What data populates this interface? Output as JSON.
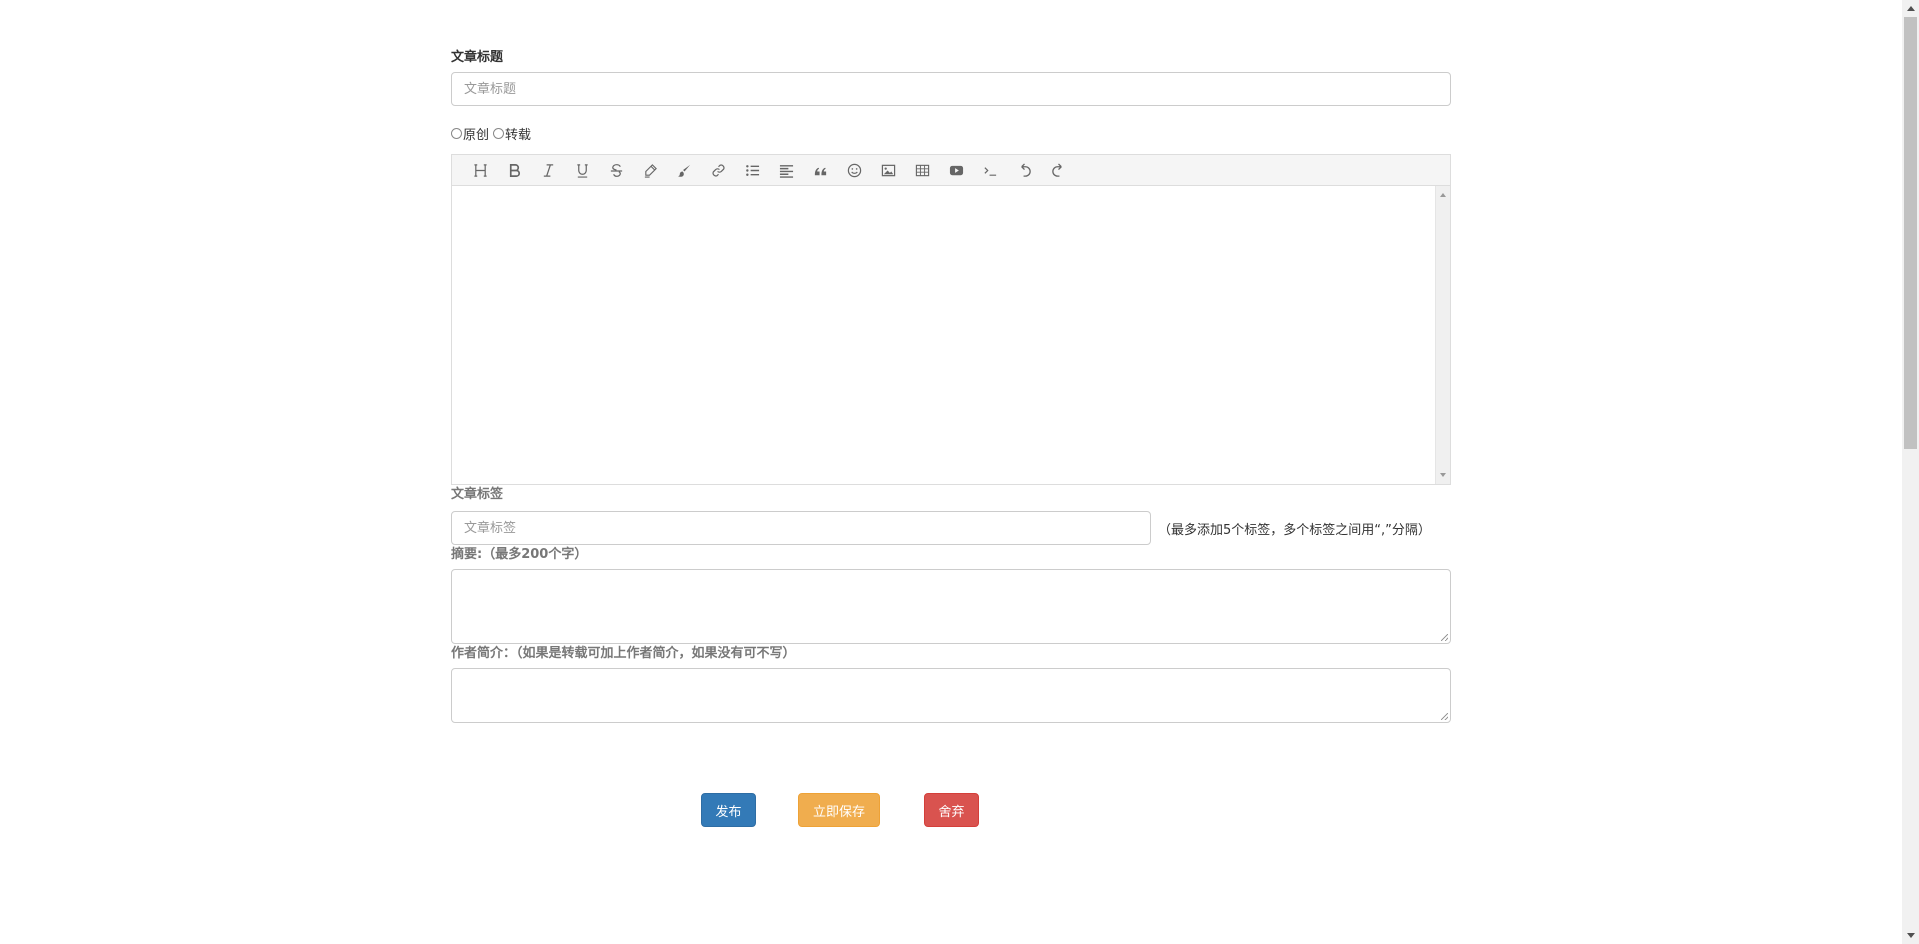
{
  "form": {
    "title_label": "文章标题",
    "title_placeholder": "文章标题",
    "title_value": "",
    "type_options": [
      {
        "label": "原创",
        "selected": false
      },
      {
        "label": "转载",
        "selected": false
      }
    ],
    "editor": {
      "toolbar": [
        "heading-icon",
        "bold-icon",
        "italic-icon",
        "underline-icon",
        "strikethrough-icon",
        "highlighter-icon",
        "paintbrush-icon",
        "link-icon",
        "bulleted-list-icon",
        "align-left-icon",
        "blockquote-icon",
        "emoji-icon",
        "image-icon",
        "table-icon",
        "video-icon",
        "code-icon",
        "undo-icon",
        "redo-icon"
      ],
      "content": ""
    },
    "tags_label": "文章标签",
    "tags_placeholder": "文章标签",
    "tags_hint": "（最多添加5个标签，多个标签之间用“,”分隔）",
    "summary_label": "摘要:（最多200个字）",
    "author_label": "作者简介：（如果是转载可加上作者简介，如果没有可不写）"
  },
  "buttons": {
    "publish": "发布",
    "save": "立即保存",
    "discard": "舍弃"
  },
  "colors": {
    "primary": "#337ab7",
    "warning": "#f0ad4e",
    "danger": "#d9534f"
  }
}
